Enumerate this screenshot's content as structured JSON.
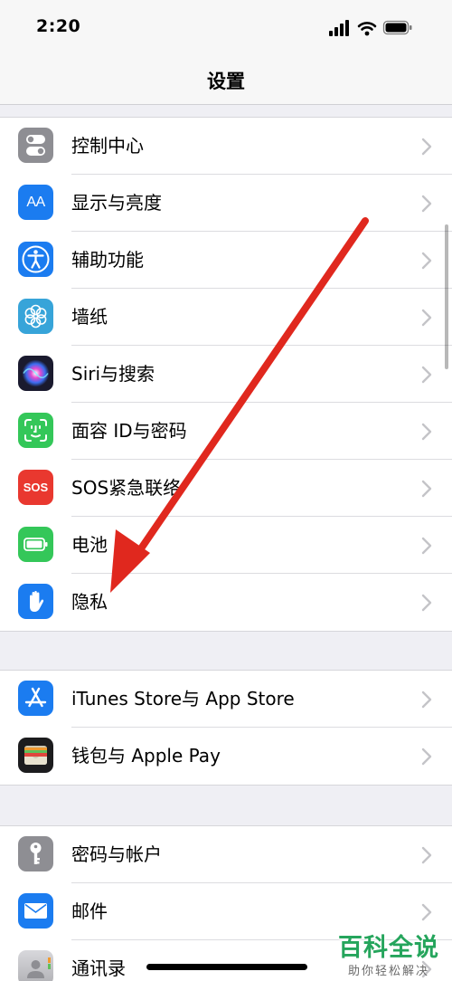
{
  "status_bar": {
    "time": "2:20"
  },
  "nav": {
    "title": "设置"
  },
  "groups": [
    {
      "items": [
        {
          "label": "控制中心",
          "icon": "control-center-icon",
          "color": "#8e8e93"
        },
        {
          "label": "显示与亮度",
          "icon": "display-brightness-icon",
          "color": "#1b7cf0",
          "glyph": "AA"
        },
        {
          "label": "辅助功能",
          "icon": "accessibility-icon",
          "color": "#1b7cf0"
        },
        {
          "label": "墙纸",
          "icon": "wallpaper-icon",
          "color": "#37a4d9"
        },
        {
          "label": "Siri与搜索",
          "icon": "siri-icon",
          "color": "#1a1a2e"
        },
        {
          "label": "面容 ID与密码",
          "icon": "face-id-icon",
          "color": "#34c759"
        },
        {
          "label": "SOS紧急联络",
          "icon": "sos-icon",
          "color": "#e9382f",
          "glyph": "SOS"
        },
        {
          "label": "电池",
          "icon": "battery-icon",
          "color": "#34c759"
        },
        {
          "label": "隐私",
          "icon": "privacy-hand-icon",
          "color": "#1b7cf0"
        }
      ]
    },
    {
      "items": [
        {
          "label": "iTunes Store与 App Store",
          "icon": "app-store-icon",
          "color": "#1b7cf0"
        },
        {
          "label": "钱包与 Apple Pay",
          "icon": "wallet-icon",
          "color": "#1c1c1e"
        }
      ]
    },
    {
      "items": [
        {
          "label": "密码与帐户",
          "icon": "key-icon",
          "color": "#8e8e93"
        },
        {
          "label": "邮件",
          "icon": "mail-icon",
          "color": "#1b7cf0"
        },
        {
          "label": "通讯录",
          "icon": "contacts-icon",
          "color": "#b0b0b4"
        }
      ]
    }
  ],
  "watermark": {
    "logo": "百科全说",
    "tagline": "助你轻松解决"
  },
  "colors": {
    "accent": "#1b7cf0",
    "annotation_arrow": "#e0281e",
    "watermark_green": "#25a55c"
  }
}
